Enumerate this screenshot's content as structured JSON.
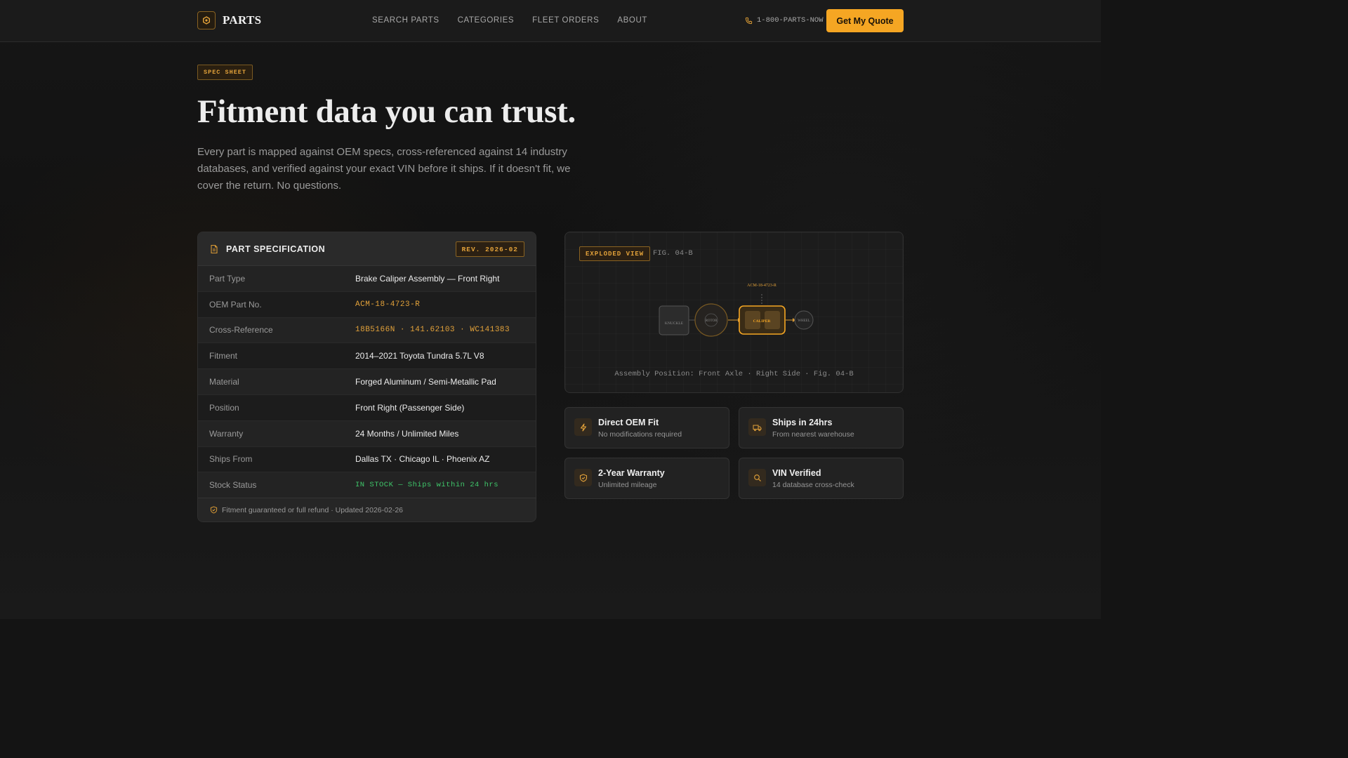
{
  "header": {
    "logo_text": "PARTS",
    "nav": [
      "SEARCH PARTS",
      "CATEGORIES",
      "FLEET ORDERS",
      "ABOUT"
    ],
    "phone": "1-800-PARTS-NOW",
    "cta_label": "Get My Quote"
  },
  "hero": {
    "chip": "SPEC SHEET",
    "title": "Fitment data you can trust.",
    "subtitle": "Every part is mapped against OEM specs, cross-referenced against 14 industry databases, and verified against your exact VIN before it ships. If it doesn't fit, we cover the return. No questions."
  },
  "spec": {
    "title": "PART SPECIFICATION",
    "revision": "REV. 2026-02",
    "rows": [
      {
        "label": "Part Type",
        "value": "Brake Caliper Assembly — Front Right"
      },
      {
        "label": "OEM Part No.",
        "value": "ACM-18-4723-R"
      },
      {
        "label": "Cross-Reference",
        "value": "18B5166N · 141.62103 · WC141383"
      },
      {
        "label": "Fitment",
        "value": "2014–2021 Toyota Tundra 5.7L V8"
      },
      {
        "label": "Material",
        "value": "Forged Aluminum / Semi-Metallic Pad"
      },
      {
        "label": "Position",
        "value": "Front Right (Passenger Side)"
      },
      {
        "label": "Warranty",
        "value": "24 Months / Unlimited Miles"
      },
      {
        "label": "Ships From",
        "value": "Dallas TX · Chicago IL · Phoenix AZ"
      },
      {
        "label": "Stock Status",
        "value": "IN STOCK — Ships within 24 hrs"
      }
    ],
    "footer": "Fitment guaranteed or full refund · Updated 2026-02-26"
  },
  "exploded": {
    "chip": "EXPLODED VIEW",
    "fig": "FIG. 04-B",
    "part_label": "ACM-18-4723-R",
    "nodes": [
      "KNUCKLE",
      "ROTOR",
      "CALIPER",
      "WHEEL"
    ],
    "caption": "Assembly Position: Front Axle · Right Side · Fig. 04-B"
  },
  "features": [
    {
      "title": "Direct OEM Fit",
      "sub": "No modifications required",
      "icon": "bolt-icon"
    },
    {
      "title": "Ships in 24hrs",
      "sub": "From nearest warehouse",
      "icon": "truck-icon"
    },
    {
      "title": "2-Year Warranty",
      "sub": "Unlimited mileage",
      "icon": "shield-icon"
    },
    {
      "title": "VIN Verified",
      "sub": "14 database cross-check",
      "icon": "search-icon"
    }
  ],
  "colors": {
    "accent": "#f5a623",
    "background": "#141414",
    "in_stock": "#3fc66a"
  }
}
